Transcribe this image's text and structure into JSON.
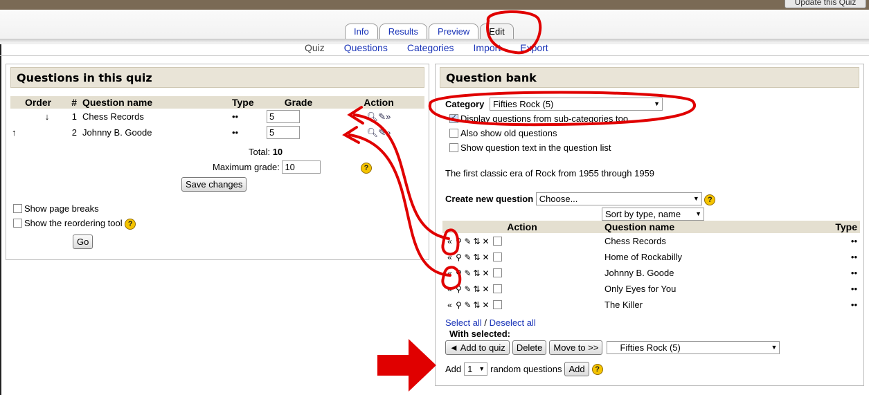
{
  "top_button": "Update this Quiz",
  "tabs": [
    "Info",
    "Results",
    "Preview",
    "Edit"
  ],
  "subtabs": [
    "Quiz",
    "Questions",
    "Categories",
    "Import",
    "Export"
  ],
  "left": {
    "title": "Questions in this quiz",
    "headers": {
      "order": "Order",
      "num": "#",
      "name": "Question name",
      "type": "Type",
      "grade": "Grade",
      "action": "Action"
    },
    "rows": [
      {
        "num": "1",
        "name": "Chess Records",
        "type": "••",
        "grade": "5"
      },
      {
        "num": "2",
        "name": "Johnny B. Goode",
        "type": "••",
        "grade": "5"
      }
    ],
    "total_label": "Total:",
    "total_value": "10",
    "max_grade_label": "Maximum grade:",
    "max_grade_value": "10",
    "save_label": "Save changes",
    "show_page_breaks": "Show page breaks",
    "show_reorder": "Show the reordering tool",
    "go_label": "Go"
  },
  "right": {
    "title": "Question bank",
    "category_label": "Category",
    "category_value": "Fifties Rock (5)",
    "opt_subcat": "Display questions from sub-categories too",
    "opt_old": "Also show old questions",
    "opt_text": "Show question text in the question list",
    "description": "The first classic era of Rock from 1955 through 1959",
    "create_label": "Create new question",
    "create_value": "Choose...",
    "sort_value": "Sort by type, name",
    "headers": {
      "action": "Action",
      "name": "Question name",
      "type": "Type"
    },
    "rows": [
      {
        "name": "Chess Records",
        "type": "••"
      },
      {
        "name": "Home of Rockabilly",
        "type": "••"
      },
      {
        "name": "Johnny B. Goode",
        "type": "••"
      },
      {
        "name": "Only Eyes for You",
        "type": "••"
      },
      {
        "name": "The Killer",
        "type": "••"
      }
    ],
    "select_all": "Select all",
    "slash": " / ",
    "deselect_all": "Deselect all",
    "with_selected": "With selected:",
    "add_to_quiz": "◄ Add to quiz",
    "delete": "Delete",
    "move_to": "Move to >>",
    "move_target": "Fifties Rock (5)",
    "add_label": "Add",
    "random_count": "1",
    "random_label": "random questions",
    "add_button": "Add"
  },
  "annotation_color": "#e00000"
}
